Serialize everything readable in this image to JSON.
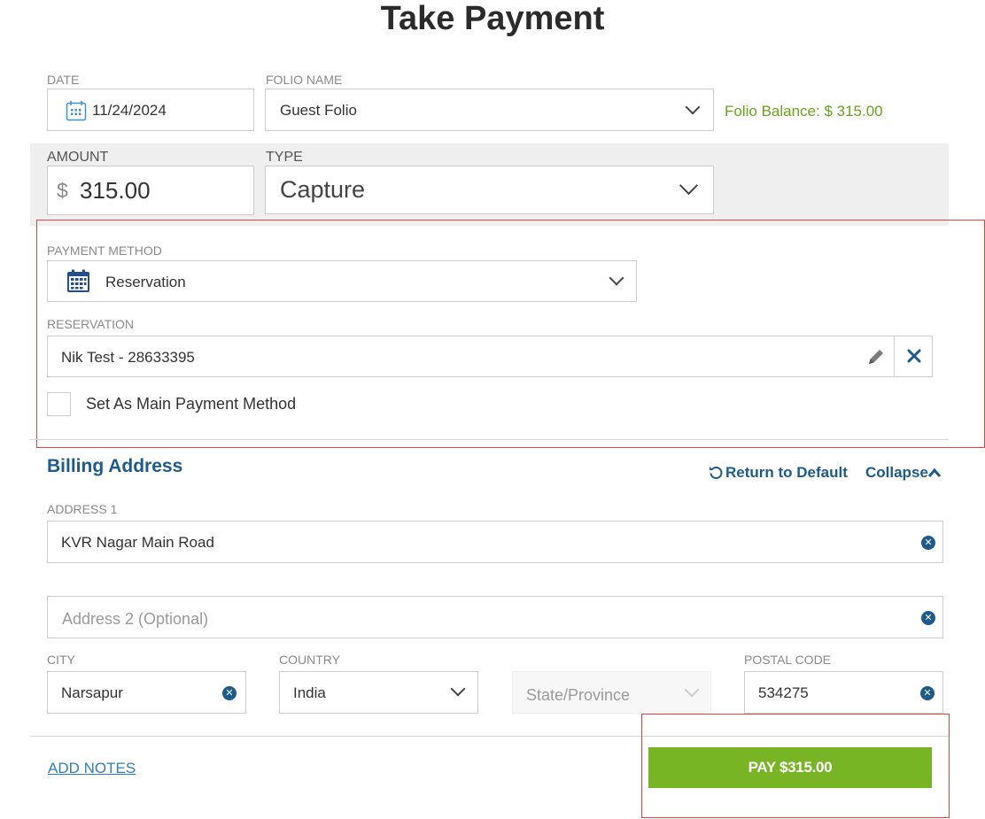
{
  "page": {
    "title": "Take Payment"
  },
  "date": {
    "label": "DATE",
    "value": "11/24/2024"
  },
  "folio": {
    "label": "FOLIO NAME",
    "value": "Guest Folio",
    "balance": "Folio Balance: $ 315.00"
  },
  "amount": {
    "label": "AMOUNT",
    "currency": "$",
    "value": "315.00"
  },
  "type": {
    "label": "TYPE",
    "value": "Capture"
  },
  "payment_method": {
    "label": "PAYMENT METHOD",
    "value": "Reservation"
  },
  "reservation": {
    "label": "RESERVATION",
    "value": "Nik Test - 28633395"
  },
  "main_method": {
    "label": "Set As Main Payment Method"
  },
  "billing": {
    "title": "Billing Address",
    "return_default": "Return to Default",
    "collapse": "Collapse",
    "address1_label": "ADDRESS 1",
    "address1_value": "KVR Nagar Main Road",
    "address2_placeholder": "Address 2 (Optional)",
    "city_label": "CITY",
    "city_value": "Narsapur",
    "country_label": "COUNTRY",
    "country_value": "India",
    "state_placeholder": "State/Province",
    "postal_label": "POSTAL CODE",
    "postal_value": "534275"
  },
  "footer": {
    "add_notes": "ADD NOTES",
    "pay_label": "PAY $315.00"
  },
  "colors": {
    "accent_green": "#77b525",
    "balance_green": "#6aa31c",
    "link_blue": "#1c5b8c",
    "highlight_red": "#e2433f"
  }
}
